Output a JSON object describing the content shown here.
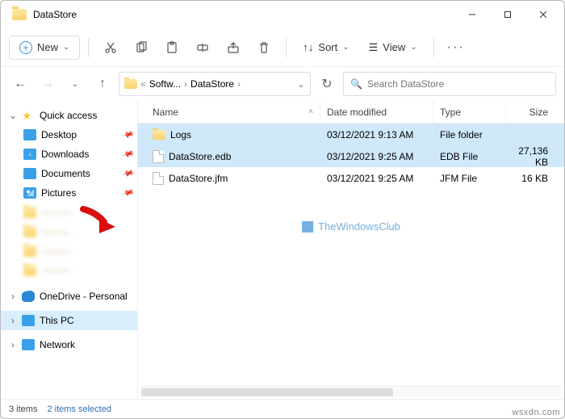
{
  "window": {
    "title": "DataStore"
  },
  "toolbar": {
    "new_label": "New",
    "sort_label": "Sort",
    "view_label": "View"
  },
  "breadcrumb": {
    "seg1": "Softw...",
    "seg2": "DataStore"
  },
  "search": {
    "placeholder": "Search DataStore"
  },
  "columns": {
    "name": "Name",
    "date": "Date modified",
    "type": "Type",
    "size": "Size"
  },
  "sidebar": {
    "quick": "Quick access",
    "desktop": "Desktop",
    "downloads": "Downloads",
    "documents": "Documents",
    "pictures": "Pictures",
    "blurred1": "———",
    "blurred2": "———",
    "blurred3": "———",
    "blurred4": "———",
    "onedrive": "OneDrive - Personal",
    "thispc": "This PC",
    "network": "Network"
  },
  "files": [
    {
      "name": "Logs",
      "date": "03/12/2021 9:13 AM",
      "type": "File folder",
      "size": ""
    },
    {
      "name": "DataStore.edb",
      "date": "03/12/2021 9:25 AM",
      "type": "EDB File",
      "size": "27,136 KB"
    },
    {
      "name": "DataStore.jfm",
      "date": "03/12/2021 9:25 AM",
      "type": "JFM File",
      "size": "16 KB"
    }
  ],
  "watermark": "TheWindowsClub",
  "status": {
    "count": "3 items",
    "selected": "2 items selected"
  },
  "attribution": "wsxdn.com"
}
